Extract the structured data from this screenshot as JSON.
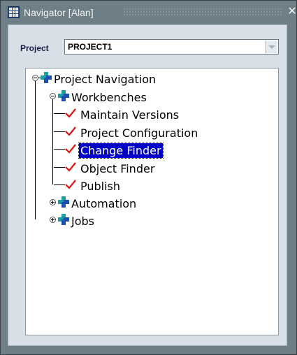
{
  "window": {
    "title": "Navigator [Alan]",
    "close_glyph": "✕"
  },
  "project": {
    "label": "Project",
    "value": "PROJECT1"
  },
  "tree": {
    "root": {
      "label": "Project Navigation",
      "expanded": true,
      "icon": "project-cross-icon"
    },
    "workbenches": {
      "label": "Workbenches",
      "expanded": true,
      "icon": "folder-cross-icon",
      "items": [
        {
          "label": "Maintain Versions",
          "icon": "checkmark-icon",
          "selected": false
        },
        {
          "label": "Project Configuration",
          "icon": "checkmark-icon",
          "selected": false
        },
        {
          "label": "Change Finder",
          "icon": "checkmark-icon",
          "selected": true
        },
        {
          "label": "Object Finder",
          "icon": "checkmark-icon",
          "selected": false
        },
        {
          "label": "Publish",
          "icon": "checkmark-icon",
          "selected": false
        }
      ]
    },
    "automation": {
      "label": "Automation",
      "expanded": false,
      "icon": "folder-cross-icon"
    },
    "jobs": {
      "label": "Jobs",
      "expanded": false,
      "icon": "folder-cross-icon"
    }
  },
  "colors": {
    "window_bg": "#6f7f87",
    "panel_bg": "#d8dfe6",
    "selection": "#0000c8",
    "cross_teal": "#1aa0a0",
    "cross_blue": "#1c4fb0",
    "check_red": "#e01010"
  }
}
